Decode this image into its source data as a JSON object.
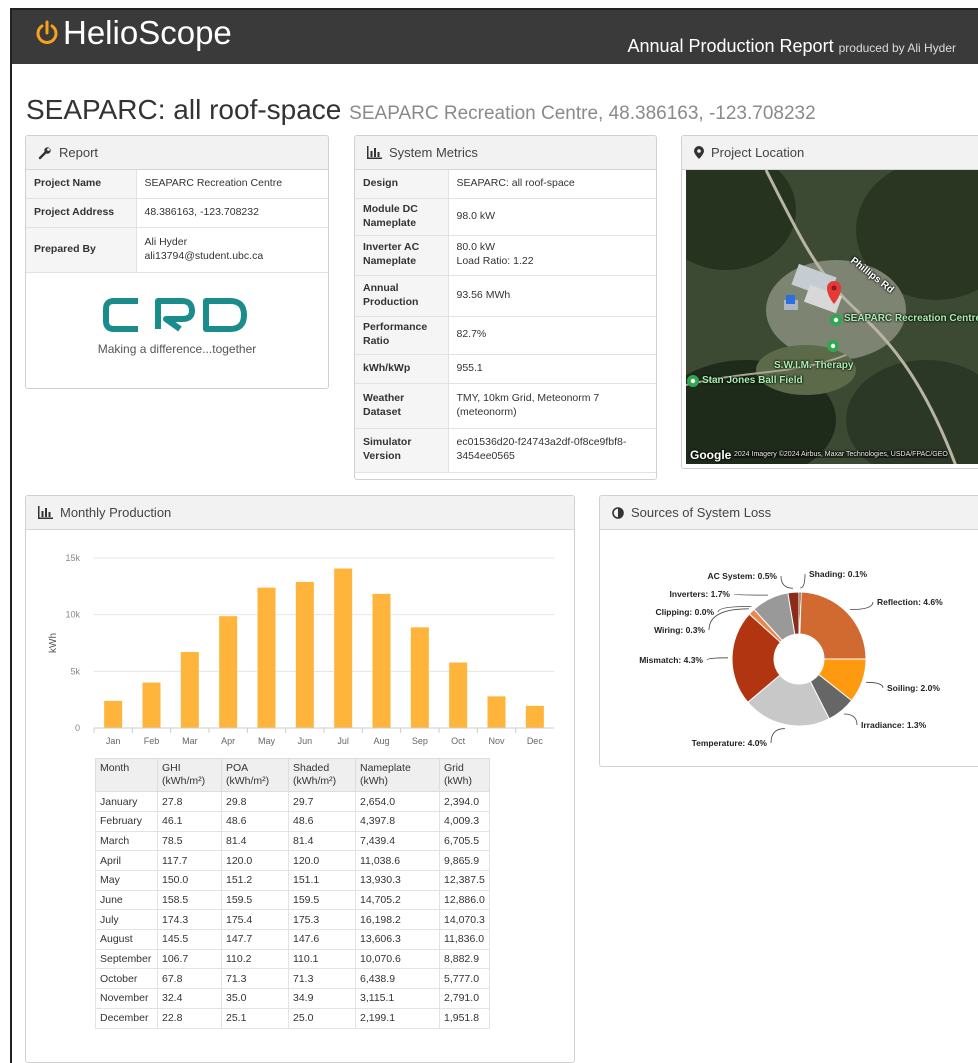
{
  "header": {
    "app_name": "HelioScope",
    "report_title": "Annual Production Report",
    "produced_by": "produced by Ali Hyder"
  },
  "project": {
    "title": "SEAPARC: all roof-space",
    "subtitle": "SEAPARC Recreation Centre, 48.386163, -123.708232"
  },
  "report_panel": {
    "heading": "Report",
    "rows": [
      {
        "key": "Project Name",
        "value": "SEAPARC Recreation Centre"
      },
      {
        "key": "Project Address",
        "value": "48.386163, -123.708232"
      },
      {
        "key": "Prepared By",
        "value": "Ali Hyder\nali13794@student.ubc.ca"
      }
    ],
    "logo_tagline": "Making a difference...together"
  },
  "metrics_panel": {
    "heading": "System Metrics",
    "rows": [
      {
        "key": "Design",
        "value": "SEAPARC: all roof-space"
      },
      {
        "key": "Module DC\nNameplate",
        "value": "98.0 kW"
      },
      {
        "key": "Inverter AC\nNameplate",
        "value": "80.0 kW\nLoad Ratio: 1.22"
      },
      {
        "key": "Annual\nProduction",
        "value": "93.56 MWh"
      },
      {
        "key": "Performance\nRatio",
        "value": "82.7%"
      },
      {
        "key": "kWh/kWp",
        "value": "955.1"
      },
      {
        "key": "Weather Dataset",
        "value": "TMY, 10km Grid, Meteonorm 7\n(meteonorm)"
      },
      {
        "key": "Simulator Version",
        "value": "ec01536d20-f24743a2df-0f8ce9fbf8-\n3454ee0565"
      }
    ]
  },
  "location_panel": {
    "heading": "Project Location",
    "labels": {
      "road": "Phillips Rd",
      "place": "SEAPARC\nRecreation Centre",
      "therapy": "S.W.I.M. Therapy",
      "field": "Stan Jones Ball Field",
      "google": "Google",
      "attribution": "2024 Imagery ©2024 Airbus, Maxar Technologies, USDA/FPAC/GEO"
    }
  },
  "monthly_panel": {
    "heading": "Monthly Production",
    "table": {
      "headers": [
        "Month",
        "GHI\n(kWh/m²)",
        "POA\n(kWh/m²)",
        "Shaded\n(kWh/m²)",
        "Nameplate\n(kWh)",
        "Grid\n(kWh)"
      ],
      "rows": [
        [
          "January",
          "27.8",
          "29.8",
          "29.7",
          "2,654.0",
          "2,394.0"
        ],
        [
          "February",
          "46.1",
          "48.6",
          "48.6",
          "4,397.8",
          "4,009.3"
        ],
        [
          "March",
          "78.5",
          "81.4",
          "81.4",
          "7,439.4",
          "6,705.5"
        ],
        [
          "April",
          "117.7",
          "120.0",
          "120.0",
          "11,038.6",
          "9,865.9"
        ],
        [
          "May",
          "150.0",
          "151.2",
          "151.1",
          "13,930.3",
          "12,387.5"
        ],
        [
          "June",
          "158.5",
          "159.5",
          "159.5",
          "14,705.2",
          "12,886.0"
        ],
        [
          "July",
          "174.3",
          "175.4",
          "175.3",
          "16,198.2",
          "14,070.3"
        ],
        [
          "August",
          "145.5",
          "147.7",
          "147.6",
          "13,606.3",
          "11,836.0"
        ],
        [
          "September",
          "106.7",
          "110.2",
          "110.1",
          "10,070.6",
          "8,882.9"
        ],
        [
          "October",
          "67.8",
          "71.3",
          "71.3",
          "6,438.9",
          "5,777.0"
        ],
        [
          "November",
          "32.4",
          "35.0",
          "34.9",
          "3,115.1",
          "2,791.0"
        ],
        [
          "December",
          "22.8",
          "25.1",
          "25.0",
          "2,199.1",
          "1,951.8"
        ]
      ]
    }
  },
  "loss_panel": {
    "heading": "Sources of System Loss"
  },
  "chart_data": [
    {
      "type": "bar",
      "categories": [
        "Jan",
        "Feb",
        "Mar",
        "Apr",
        "May",
        "Jun",
        "Jul",
        "Aug",
        "Sep",
        "Oct",
        "Nov",
        "Dec"
      ],
      "values": [
        2394.0,
        4009.3,
        6705.5,
        9865.9,
        12387.5,
        12886.0,
        14070.3,
        11836.0,
        8882.9,
        5777.0,
        2791.0,
        1951.8
      ],
      "ylabel": "kWh",
      "ylim": [
        0,
        15000
      ],
      "yticks": [
        "0",
        "5k",
        "10k",
        "15k"
      ],
      "color": "#ffb43c",
      "grid": true
    },
    {
      "type": "pie",
      "donut": true,
      "slices": [
        {
          "label": "Shading: 0.1%",
          "value": 0.1,
          "color": "#7a1a10"
        },
        {
          "label": "Reflection: 4.6%",
          "value": 4.6,
          "color": "#d06a30"
        },
        {
          "label": "Soiling: 2.0%",
          "value": 2.0,
          "color": "#ff9a10"
        },
        {
          "label": "Irradiance: 1.3%",
          "value": 1.3,
          "color": "#666666"
        },
        {
          "label": "Temperature: 4.0%",
          "value": 4.0,
          "color": "#c8c8c8"
        },
        {
          "label": "Mismatch: 4.3%",
          "value": 4.3,
          "color": "#b03510"
        },
        {
          "label": "Wiring: 0.3%",
          "value": 0.3,
          "color": "#e88a50"
        },
        {
          "label": "Clipping: 0.0%",
          "value": 0.0,
          "color": "#ff6a00"
        },
        {
          "label": "Inverters: 1.7%",
          "value": 1.7,
          "color": "#999999"
        },
        {
          "label": "AC System: 0.5%",
          "value": 0.5,
          "color": "#8a2c18"
        }
      ]
    }
  ]
}
